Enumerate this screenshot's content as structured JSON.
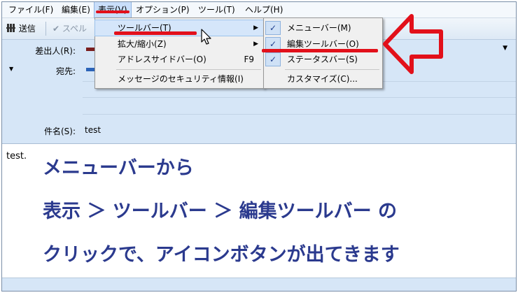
{
  "menubar": {
    "items": [
      {
        "label": "ファイル(F)"
      },
      {
        "label": "編集(E)"
      },
      {
        "label": "表示(V)"
      },
      {
        "label": "オプション(P)"
      },
      {
        "label": "ツール(T)"
      },
      {
        "label": "ヘルプ(H)"
      }
    ]
  },
  "toolbar": {
    "send_label": "送信",
    "spell_label": "スペル"
  },
  "header": {
    "from_label": "差出人(R):",
    "to_label": "宛先:",
    "subject_label": "件名(S):",
    "subject_value": "test"
  },
  "body": {
    "text": "test.",
    "overlay_lines": [
      "メニューバーから",
      "表示 ＞ ツールバー ＞ 編集ツールバー の",
      "クリックで、アイコンボタンが出てきます"
    ]
  },
  "view_menu": {
    "items": [
      {
        "label": "ツールバー(T)",
        "shortcut": ""
      },
      {
        "label": "拡大/縮小(Z)",
        "shortcut": ""
      },
      {
        "label": "アドレスサイドバー(O)",
        "shortcut": "F9"
      },
      {
        "label": "メッセージのセキュリティ情報(I)",
        "shortcut": ""
      }
    ]
  },
  "toolbar_submenu": {
    "items": [
      {
        "label": "メニューバー(M)",
        "checked": true
      },
      {
        "label": "編集ツールバー(O)",
        "checked": true
      },
      {
        "label": "ステータスバー(S)",
        "checked": true
      },
      {
        "label": "カスタマイズ(C)...",
        "checked": false
      }
    ]
  },
  "colors": {
    "annotation_red": "#e2101a",
    "overlay_text": "#2b3a8e",
    "menu_highlight": "#d5e6fa"
  }
}
